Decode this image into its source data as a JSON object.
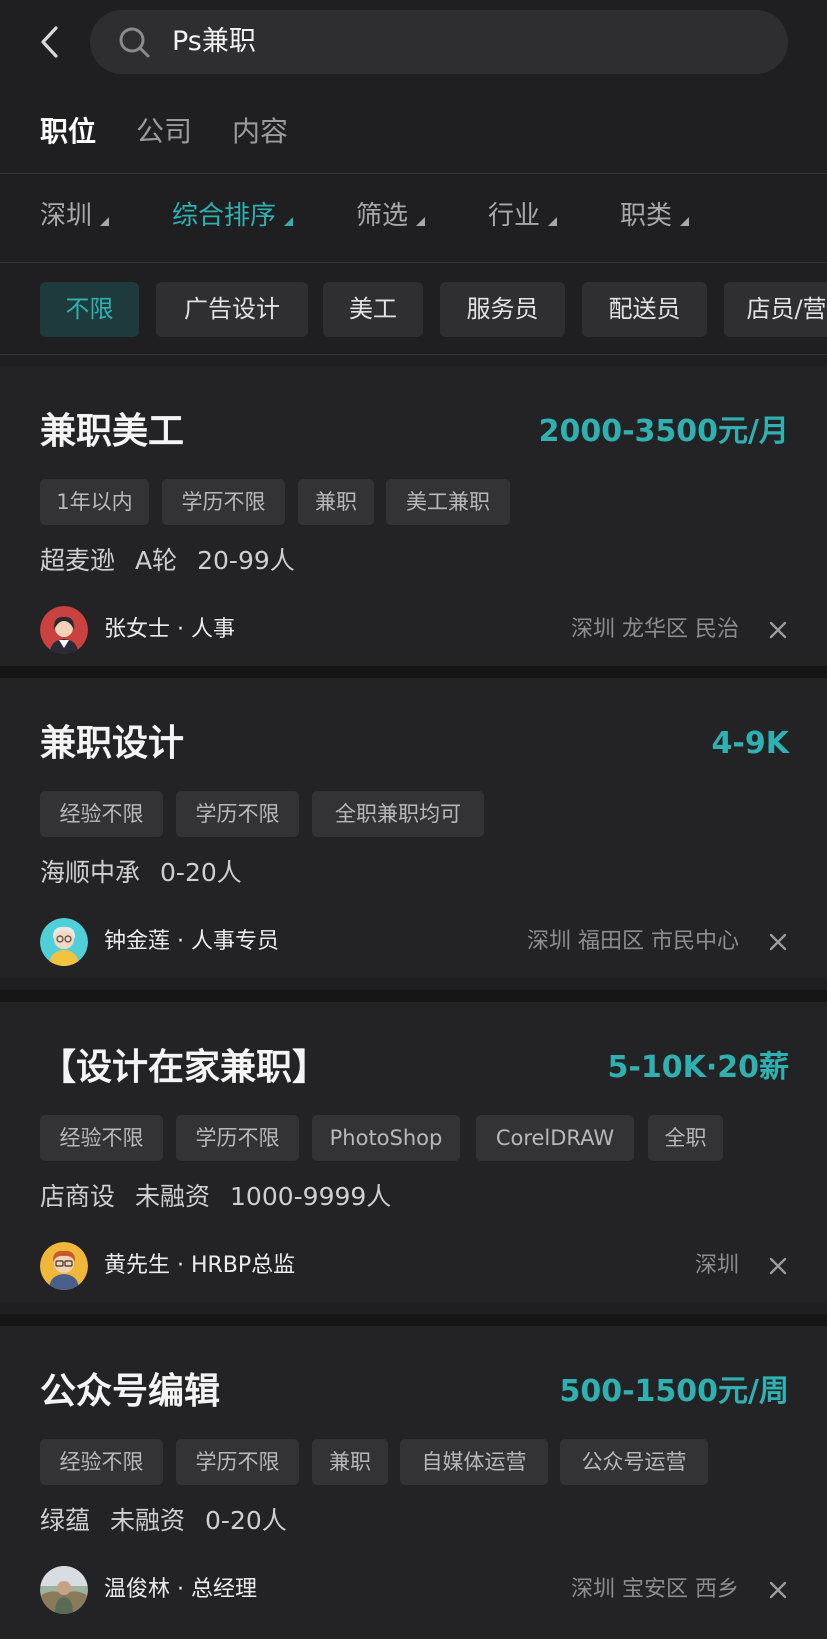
{
  "search": {
    "query": "Ps兼职"
  },
  "tabs": [
    {
      "label": "职位",
      "active": true
    },
    {
      "label": "公司",
      "active": false
    },
    {
      "label": "内容",
      "active": false
    }
  ],
  "filters": [
    {
      "label": "深圳",
      "active": false
    },
    {
      "label": "综合排序",
      "active": true
    },
    {
      "label": "筛选",
      "active": false
    },
    {
      "label": "行业",
      "active": false
    },
    {
      "label": "职类",
      "active": false
    }
  ],
  "chips": [
    {
      "label": "不限",
      "active": true
    },
    {
      "label": "广告设计",
      "active": false
    },
    {
      "label": "美工",
      "active": false
    },
    {
      "label": "服务员",
      "active": false
    },
    {
      "label": "配送员",
      "active": false
    },
    {
      "label": "店员/营",
      "active": false
    }
  ],
  "colors": {
    "accent": "#2fb1b1",
    "background": "#1f1f21",
    "card": "#232325"
  },
  "jobs": [
    {
      "title": "兼职美工",
      "salary": "2000-3500元/月",
      "tags": [
        "1年以内",
        "学历不限",
        "兼职",
        "美工兼职"
      ],
      "company": [
        "超麦逊",
        "A轮",
        "20-99人"
      ],
      "person": "张女士 · 人事",
      "location": "深圳 龙华区 民治",
      "avatar": "female-avatar-red"
    },
    {
      "title": "兼职设计",
      "salary": "4-9K",
      "tags": [
        "经验不限",
        "学历不限",
        "全职兼职均可"
      ],
      "company": [
        "海顺中承",
        "0-20人"
      ],
      "person": "钟金莲 · 人事专员",
      "location": "深圳 福田区 市民中心",
      "avatar": "elder-avatar-cyan"
    },
    {
      "title": "【设计在家兼职】",
      "salary": "5-10K·20薪",
      "tags": [
        "经验不限",
        "学历不限",
        "PhotoShop",
        "CorelDRAW",
        "全职"
      ],
      "company": [
        "店商设",
        "未融资",
        "1000-9999人"
      ],
      "person": "黄先生 · HRBP总监",
      "location": "深圳",
      "avatar": "male-avatar-yellow"
    },
    {
      "title": "公众号编辑",
      "salary": "500-1500元/周",
      "tags": [
        "经验不限",
        "学历不限",
        "兼职",
        "自媒体运营",
        "公众号运营"
      ],
      "company": [
        "绿蕴",
        "未融资",
        "0-20人"
      ],
      "person": "温俊林 · 总经理",
      "location": "深圳 宝安区 西乡",
      "avatar": "photo-avatar"
    }
  ]
}
